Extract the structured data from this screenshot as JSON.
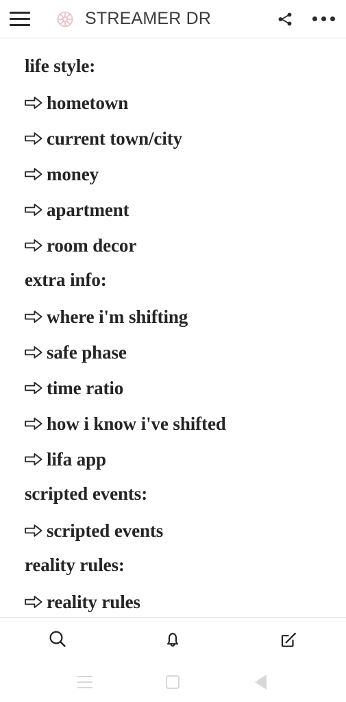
{
  "appbar": {
    "menu_icon": "hamburger-menu-icon",
    "app_icon": "flower-blog-icon",
    "app_icon_color": "#e7bcc4",
    "title": "STREAMER DR",
    "share_icon": "share-icon",
    "overflow_icon": "more-options-icon"
  },
  "content": {
    "arrow_glyph": "right-arrow-icon",
    "text_color": "#252525",
    "lines": [
      {
        "type": "heading",
        "text": "life style:"
      },
      {
        "type": "item",
        "text": "hometown"
      },
      {
        "type": "item",
        "text": "current town/city"
      },
      {
        "type": "item",
        "text": "money"
      },
      {
        "type": "item",
        "text": "apartment"
      },
      {
        "type": "item",
        "text": "room decor"
      },
      {
        "type": "heading",
        "text": "extra info:"
      },
      {
        "type": "item",
        "text": "where i'm shifting"
      },
      {
        "type": "item",
        "text": "safe phase"
      },
      {
        "type": "item",
        "text": "time ratio"
      },
      {
        "type": "item",
        "text": "how i know i've shifted"
      },
      {
        "type": "item",
        "text": "lifa app"
      },
      {
        "type": "heading",
        "text": "scripted events:"
      },
      {
        "type": "item",
        "text": "scripted events"
      },
      {
        "type": "heading",
        "text": "reality rules:"
      },
      {
        "type": "item",
        "text": "reality rules"
      }
    ]
  },
  "bottombar": {
    "items": [
      {
        "name": "search-icon",
        "label": "Search"
      },
      {
        "name": "notifications-bell-icon",
        "label": "Notifications"
      },
      {
        "name": "compose-edit-icon",
        "label": "Compose"
      }
    ]
  },
  "navbar": {
    "items": [
      {
        "name": "android-recents-button",
        "label": "Recents"
      },
      {
        "name": "android-home-button",
        "label": "Home"
      },
      {
        "name": "android-back-button",
        "label": "Back"
      }
    ],
    "color": "#d8d8d8"
  }
}
